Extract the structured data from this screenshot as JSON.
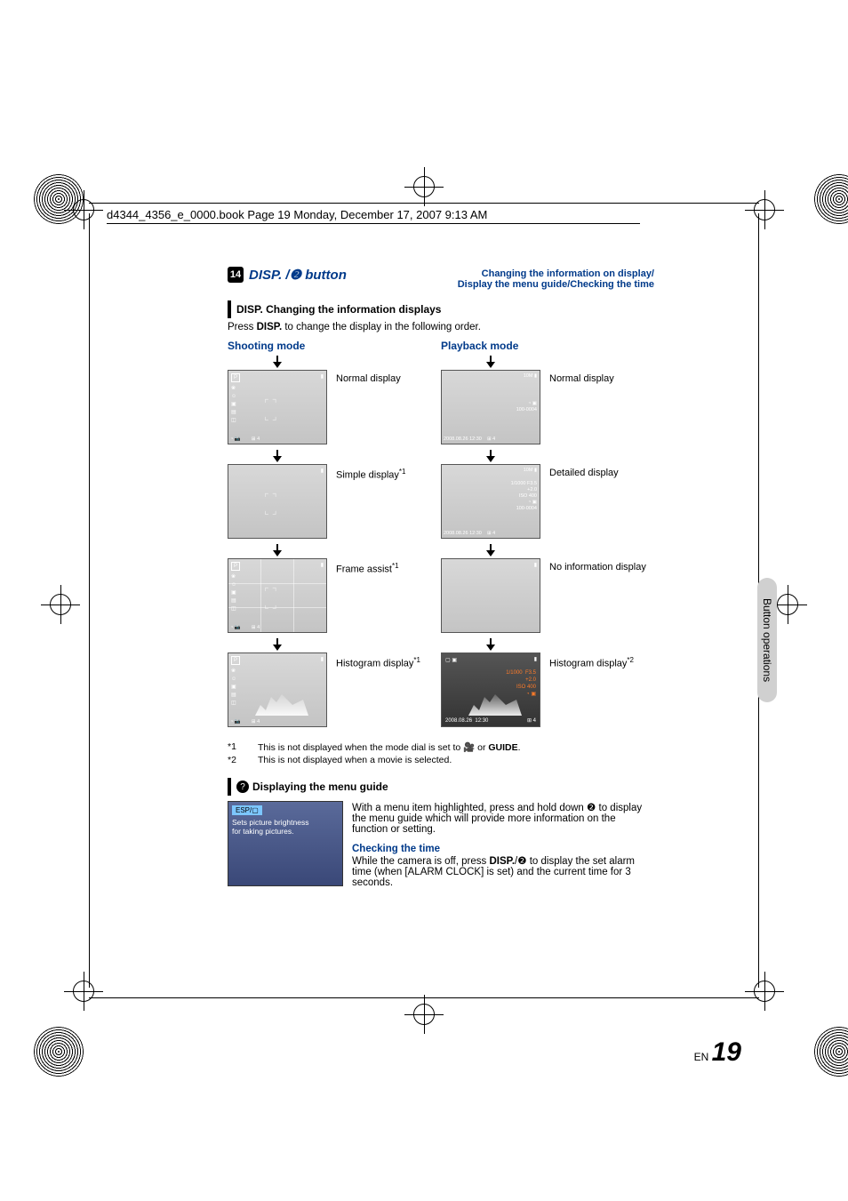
{
  "book_header": "d4344_4356_e_0000.book  Page 19  Monday, December 17, 2007  9:13 AM",
  "title_number": "14",
  "title_main_prefix": "DISP. /",
  "title_main_suffix": " button",
  "title_sub_line1": "Changing the information on display/",
  "title_sub_line2": "Display the menu guide/Checking the time",
  "section_disp": "DISP.",
  "section_title_rest": "Changing the information displays",
  "section_body_prefix": "Press ",
  "section_body_disp": "DISP.",
  "section_body_suffix": " to change the display in the following order.",
  "shooting_mode_label": "Shooting mode",
  "playback_mode_label": "Playback mode",
  "labels": {
    "normal_display": "Normal display",
    "simple_display": "Simple display",
    "frame_assist": "Frame assist",
    "histogram_display": "Histogram display",
    "detailed_display": "Detailed display",
    "no_info_display": "No information display"
  },
  "sup1": "*1",
  "sup2": "*2",
  "footnotes": {
    "f1_tag": "*1",
    "f1_text_a": "This is not displayed when the mode dial is set to ",
    "f1_text_b": " or ",
    "f1_text_c": ".",
    "f1_icon1": "🎥",
    "f1_icon2": "GUIDE",
    "f2_tag": "*2",
    "f2_text": "This is not displayed when a movie is selected."
  },
  "menu_guide_title": "Displaying the menu guide",
  "menu_guide_icon": "?",
  "guide_box": {
    "esp": "ESP/▢",
    "line1": "Sets picture brightness",
    "line2": "for taking pictures."
  },
  "guide_para1_a": "With a menu item highlighted, press and hold down ",
  "guide_para1_b": " to display the menu guide which will provide more information on the function or setting.",
  "checking_time_head": "Checking the time",
  "checking_time_body_a": "While the camera is off, press ",
  "checking_time_body_disp": "DISP.",
  "checking_time_body_b": "/",
  "checking_time_body_c": " to display the set alarm time (when [ALARM CLOCK] is set) and the current time for 3 seconds.",
  "side_tab": "Button operations",
  "page_en": "EN",
  "page_num": "19",
  "hist_thumb": {
    "shutter": "1/1000",
    "fnum": "F3.5",
    "ev": "+2.0",
    "iso": "ISO 400",
    "date": "2008.08.26",
    "time": "12:30",
    "count": "4"
  },
  "detail_thumb": {
    "top": "10M",
    "shutter": "1/1000  F3.5",
    "ev": "+2.0",
    "iso": "ISO 400",
    "file": "100-0004",
    "date": "2008.08.26",
    "time": "12:30",
    "count": "4"
  },
  "normal_pb_thumb": {
    "top": "10M",
    "file": "100-0004",
    "date": "2008.08.26",
    "time": "12:30",
    "count": "4"
  },
  "shoot_thumb": {
    "p": "P",
    "count": "4",
    "bottom": "IN"
  }
}
